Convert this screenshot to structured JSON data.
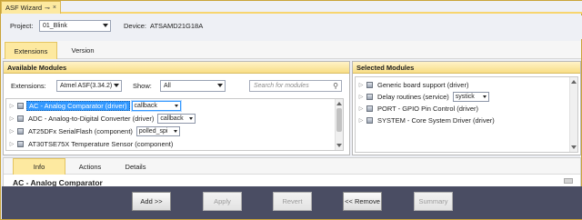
{
  "window": {
    "tab_title": "ASF Wizard",
    "pin_glyph": "⊸",
    "close_glyph": "×"
  },
  "toprow": {
    "project_label": "Project:",
    "project_value": "01_Blink",
    "device_label": "Device:",
    "device_value": "ATSAMD21G18A"
  },
  "tabs": [
    {
      "label": "Extensions",
      "active": true
    },
    {
      "label": "Version",
      "active": false
    }
  ],
  "available": {
    "title": "Available Modules",
    "extensions_label": "Extensions:",
    "extensions_value": "Atmel ASF(3.34.2)",
    "show_label": "Show:",
    "show_value": "All",
    "search_placeholder": "Search for modules",
    "modules": [
      {
        "label": "AC - Analog Comparator (driver)",
        "option": "callback",
        "selected": true
      },
      {
        "label": "ADC - Analog-to-Digital Converter (driver)",
        "option": "callback",
        "selected": false
      },
      {
        "label": "AT25DFx SerialFlash (component)",
        "option": "polled_spi",
        "selected": false
      },
      {
        "label": "AT30TSE75X Temperature Sensor (component)",
        "option": "",
        "selected": false
      }
    ]
  },
  "selected": {
    "title": "Selected Modules",
    "modules": [
      {
        "label": "Generic board support (driver)",
        "option": ""
      },
      {
        "label": "Delay routines (service)",
        "option": "systick"
      },
      {
        "label": "PORT - GPIO Pin Control (driver)",
        "option": ""
      },
      {
        "label": "SYSTEM - Core System Driver (driver)",
        "option": ""
      }
    ]
  },
  "bottom_tabs": [
    {
      "label": "Info",
      "active": true
    },
    {
      "label": "Actions",
      "active": false
    },
    {
      "label": "Details",
      "active": false
    }
  ],
  "info_title": "AC - Analog Comparator",
  "buttons": {
    "add": "Add >>",
    "apply": "Apply",
    "revert": "Revert",
    "remove": "<< Remove",
    "summary": "Summary"
  }
}
